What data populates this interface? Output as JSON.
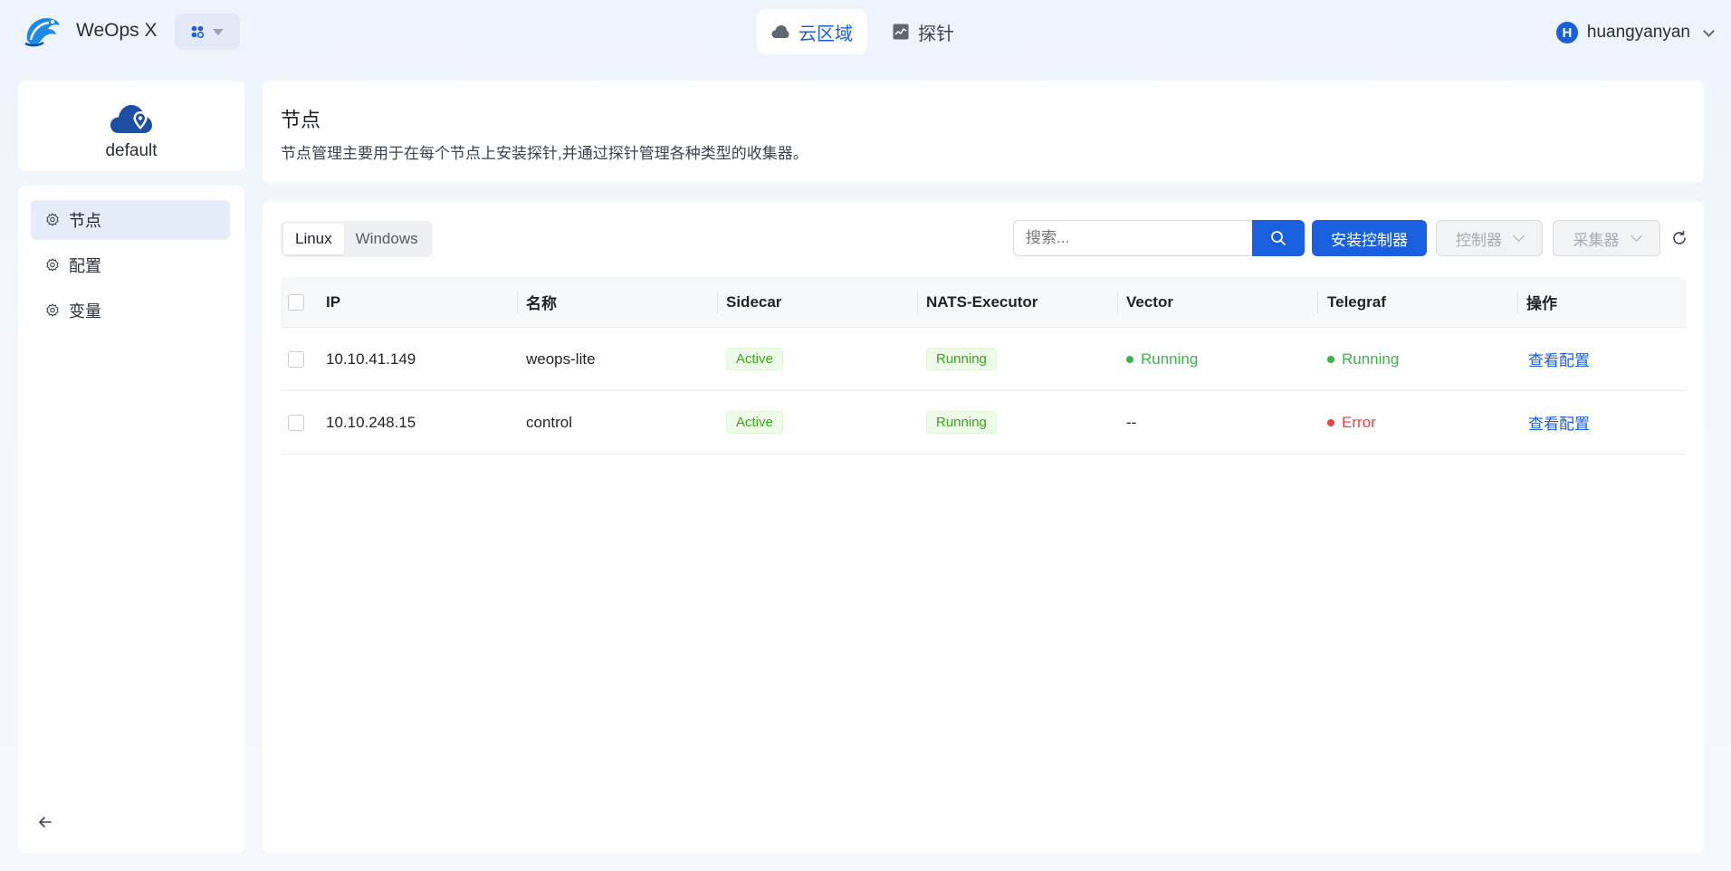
{
  "topbar": {
    "app_title": "WeOps X",
    "nav": [
      {
        "label": "云区域",
        "icon": "cloud-icon",
        "active": true
      },
      {
        "label": "探针",
        "icon": "probe-icon",
        "active": false
      }
    ],
    "user": {
      "avatar_letter": "H",
      "name": "huangyanyan"
    }
  },
  "sidebar": {
    "cloud_name": "default",
    "items": [
      {
        "label": "节点",
        "icon": "gear-icon",
        "active": true
      },
      {
        "label": "配置",
        "icon": "gear-icon",
        "active": false
      },
      {
        "label": "变量",
        "icon": "gear-icon",
        "active": false
      }
    ]
  },
  "header": {
    "title": "节点",
    "description": "节点管理主要用于在每个节点上安装探针,并通过探针管理各种类型的收集器。"
  },
  "toolbar": {
    "os_tabs": [
      "Linux",
      "Windows"
    ],
    "active_os": "Linux",
    "search_placeholder": "搜索...",
    "install_label": "安装控制器",
    "controller_label": "控制器",
    "collector_label": "采集器"
  },
  "table": {
    "columns": [
      "IP",
      "名称",
      "Sidecar",
      "NATS-Executor",
      "Vector",
      "Telegraf",
      "操作"
    ],
    "rows": [
      {
        "ip": "10.10.41.149",
        "name": "weops-lite",
        "sidecar": "Active",
        "nats": "Running",
        "vector": "Running",
        "telegraf": "Running",
        "action": "查看配置"
      },
      {
        "ip": "10.10.248.15",
        "name": "control",
        "sidecar": "Active",
        "nats": "Running",
        "vector": "--",
        "telegraf": "Error",
        "action": "查看配置"
      }
    ]
  },
  "colors": {
    "primary": "#1a5fe0",
    "success": "#3bb54a",
    "error": "#e64545"
  }
}
